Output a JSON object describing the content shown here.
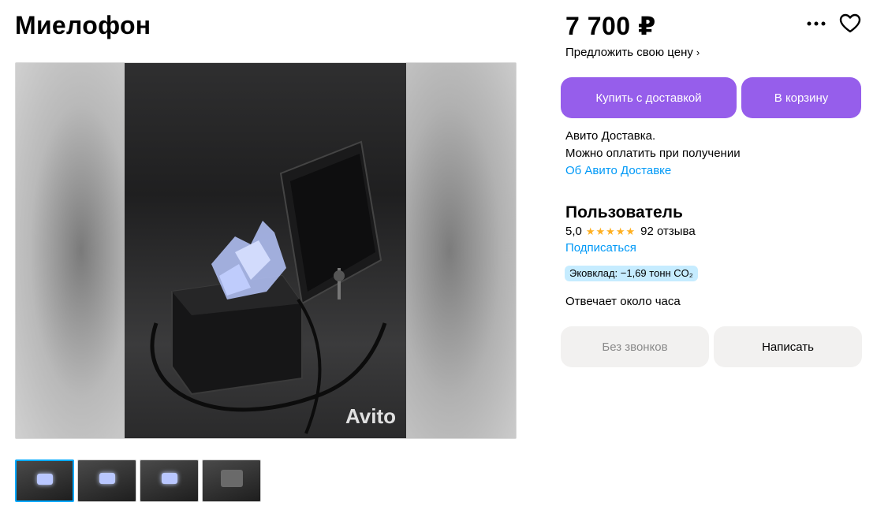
{
  "listing": {
    "title": "Миелофон",
    "price": "7 700 ₽",
    "offer_price_label": "Предложить свою цену",
    "offer_chevron": "›"
  },
  "gallery": {
    "watermark": "Avito",
    "thumbnails_count": 4,
    "active_thumbnail_index": 0
  },
  "actions": {
    "buy_with_delivery": "Купить с доставкой",
    "add_to_cart": "В корзину",
    "more_icon": "more-dots-icon",
    "favorite_icon": "heart-icon"
  },
  "delivery": {
    "line1": "Авито Доставка.",
    "line2": "Можно оплатить при получении",
    "about_link": "Об Авито Доставке"
  },
  "seller": {
    "name": "Пользователь",
    "rating": "5,0",
    "stars": "★★★★★",
    "reviews": "92 отзыва",
    "subscribe": "Подписаться",
    "eco_badge": "Эковклад: −1,69 тонн CO₂",
    "response_time": "Отвечает около часа"
  },
  "contact": {
    "no_calls": "Без звонков",
    "write": "Написать"
  },
  "colors": {
    "accent_purple": "#965eeb",
    "link_blue": "#0099f7",
    "star_orange": "#ffb021",
    "eco_bg": "#c6ecff",
    "secondary_btn_bg": "#f2f1f0",
    "active_thumb_border": "#00aaff"
  }
}
